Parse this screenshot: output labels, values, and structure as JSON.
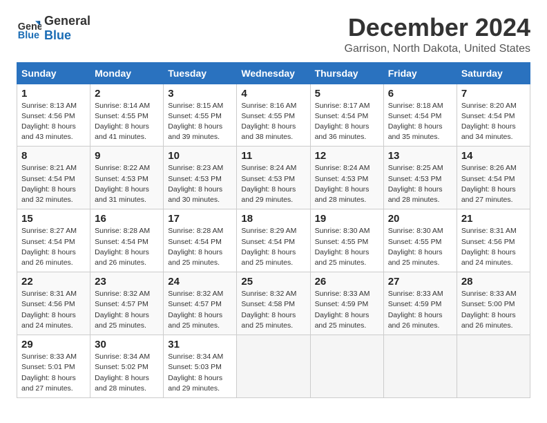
{
  "header": {
    "logo_line1": "General",
    "logo_line2": "Blue",
    "month": "December 2024",
    "location": "Garrison, North Dakota, United States"
  },
  "weekdays": [
    "Sunday",
    "Monday",
    "Tuesday",
    "Wednesday",
    "Thursday",
    "Friday",
    "Saturday"
  ],
  "weeks": [
    [
      {
        "day": "1",
        "info": "Sunrise: 8:13 AM\nSunset: 4:56 PM\nDaylight: 8 hours\nand 43 minutes."
      },
      {
        "day": "2",
        "info": "Sunrise: 8:14 AM\nSunset: 4:55 PM\nDaylight: 8 hours\nand 41 minutes."
      },
      {
        "day": "3",
        "info": "Sunrise: 8:15 AM\nSunset: 4:55 PM\nDaylight: 8 hours\nand 39 minutes."
      },
      {
        "day": "4",
        "info": "Sunrise: 8:16 AM\nSunset: 4:55 PM\nDaylight: 8 hours\nand 38 minutes."
      },
      {
        "day": "5",
        "info": "Sunrise: 8:17 AM\nSunset: 4:54 PM\nDaylight: 8 hours\nand 36 minutes."
      },
      {
        "day": "6",
        "info": "Sunrise: 8:18 AM\nSunset: 4:54 PM\nDaylight: 8 hours\nand 35 minutes."
      },
      {
        "day": "7",
        "info": "Sunrise: 8:20 AM\nSunset: 4:54 PM\nDaylight: 8 hours\nand 34 minutes."
      }
    ],
    [
      {
        "day": "8",
        "info": "Sunrise: 8:21 AM\nSunset: 4:54 PM\nDaylight: 8 hours\nand 32 minutes."
      },
      {
        "day": "9",
        "info": "Sunrise: 8:22 AM\nSunset: 4:53 PM\nDaylight: 8 hours\nand 31 minutes."
      },
      {
        "day": "10",
        "info": "Sunrise: 8:23 AM\nSunset: 4:53 PM\nDaylight: 8 hours\nand 30 minutes."
      },
      {
        "day": "11",
        "info": "Sunrise: 8:24 AM\nSunset: 4:53 PM\nDaylight: 8 hours\nand 29 minutes."
      },
      {
        "day": "12",
        "info": "Sunrise: 8:24 AM\nSunset: 4:53 PM\nDaylight: 8 hours\nand 28 minutes."
      },
      {
        "day": "13",
        "info": "Sunrise: 8:25 AM\nSunset: 4:53 PM\nDaylight: 8 hours\nand 28 minutes."
      },
      {
        "day": "14",
        "info": "Sunrise: 8:26 AM\nSunset: 4:54 PM\nDaylight: 8 hours\nand 27 minutes."
      }
    ],
    [
      {
        "day": "15",
        "info": "Sunrise: 8:27 AM\nSunset: 4:54 PM\nDaylight: 8 hours\nand 26 minutes."
      },
      {
        "day": "16",
        "info": "Sunrise: 8:28 AM\nSunset: 4:54 PM\nDaylight: 8 hours\nand 26 minutes."
      },
      {
        "day": "17",
        "info": "Sunrise: 8:28 AM\nSunset: 4:54 PM\nDaylight: 8 hours\nand 25 minutes."
      },
      {
        "day": "18",
        "info": "Sunrise: 8:29 AM\nSunset: 4:54 PM\nDaylight: 8 hours\nand 25 minutes."
      },
      {
        "day": "19",
        "info": "Sunrise: 8:30 AM\nSunset: 4:55 PM\nDaylight: 8 hours\nand 25 minutes."
      },
      {
        "day": "20",
        "info": "Sunrise: 8:30 AM\nSunset: 4:55 PM\nDaylight: 8 hours\nand 25 minutes."
      },
      {
        "day": "21",
        "info": "Sunrise: 8:31 AM\nSunset: 4:56 PM\nDaylight: 8 hours\nand 24 minutes."
      }
    ],
    [
      {
        "day": "22",
        "info": "Sunrise: 8:31 AM\nSunset: 4:56 PM\nDaylight: 8 hours\nand 24 minutes."
      },
      {
        "day": "23",
        "info": "Sunrise: 8:32 AM\nSunset: 4:57 PM\nDaylight: 8 hours\nand 25 minutes."
      },
      {
        "day": "24",
        "info": "Sunrise: 8:32 AM\nSunset: 4:57 PM\nDaylight: 8 hours\nand 25 minutes."
      },
      {
        "day": "25",
        "info": "Sunrise: 8:32 AM\nSunset: 4:58 PM\nDaylight: 8 hours\nand 25 minutes."
      },
      {
        "day": "26",
        "info": "Sunrise: 8:33 AM\nSunset: 4:59 PM\nDaylight: 8 hours\nand 25 minutes."
      },
      {
        "day": "27",
        "info": "Sunrise: 8:33 AM\nSunset: 4:59 PM\nDaylight: 8 hours\nand 26 minutes."
      },
      {
        "day": "28",
        "info": "Sunrise: 8:33 AM\nSunset: 5:00 PM\nDaylight: 8 hours\nand 26 minutes."
      }
    ],
    [
      {
        "day": "29",
        "info": "Sunrise: 8:33 AM\nSunset: 5:01 PM\nDaylight: 8 hours\nand 27 minutes."
      },
      {
        "day": "30",
        "info": "Sunrise: 8:34 AM\nSunset: 5:02 PM\nDaylight: 8 hours\nand 28 minutes."
      },
      {
        "day": "31",
        "info": "Sunrise: 8:34 AM\nSunset: 5:03 PM\nDaylight: 8 hours\nand 29 minutes."
      },
      null,
      null,
      null,
      null
    ]
  ]
}
